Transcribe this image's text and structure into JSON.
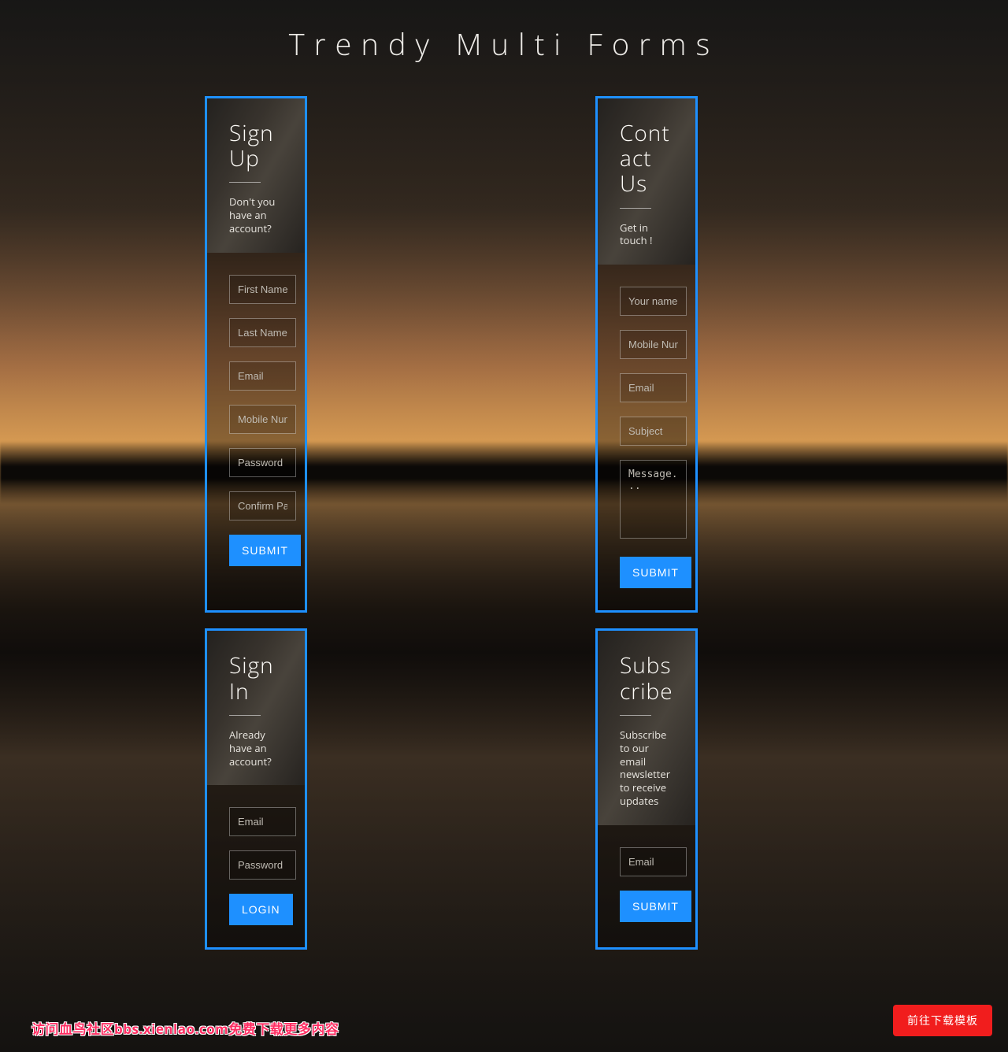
{
  "page_title": "Trendy Multi Forms",
  "float_button": "前往下载模板",
  "watermark": "访问血鸟社区bbs.xienlao.com免费下载更多内容",
  "forms": {
    "signup": {
      "title": "Sign Up",
      "subtitle": "Don't you have an account?",
      "fields": {
        "first_name": "First Name",
        "last_name": "Last Name",
        "email": "Email",
        "mobile": "Mobile Number",
        "password": "Password",
        "confirm_password": "Confirm Password"
      },
      "submit": "SUBMIT"
    },
    "contact": {
      "title": "Contact Us",
      "subtitle": "Get in touch !",
      "fields": {
        "name": "Your name",
        "mobile": "Mobile Number",
        "email": "Email",
        "subject": "Subject",
        "message": "Message..."
      },
      "submit": "SUBMIT"
    },
    "signin": {
      "title": "Sign In",
      "subtitle": "Already have an account?",
      "fields": {
        "email": "Email",
        "password": "Password"
      },
      "submit": "LOGIN"
    },
    "subscribe": {
      "title": "Subscribe",
      "subtitle": "Subscribe to our email newsletter to receive updates",
      "fields": {
        "email": "Email"
      },
      "submit": "SUBMIT"
    }
  }
}
